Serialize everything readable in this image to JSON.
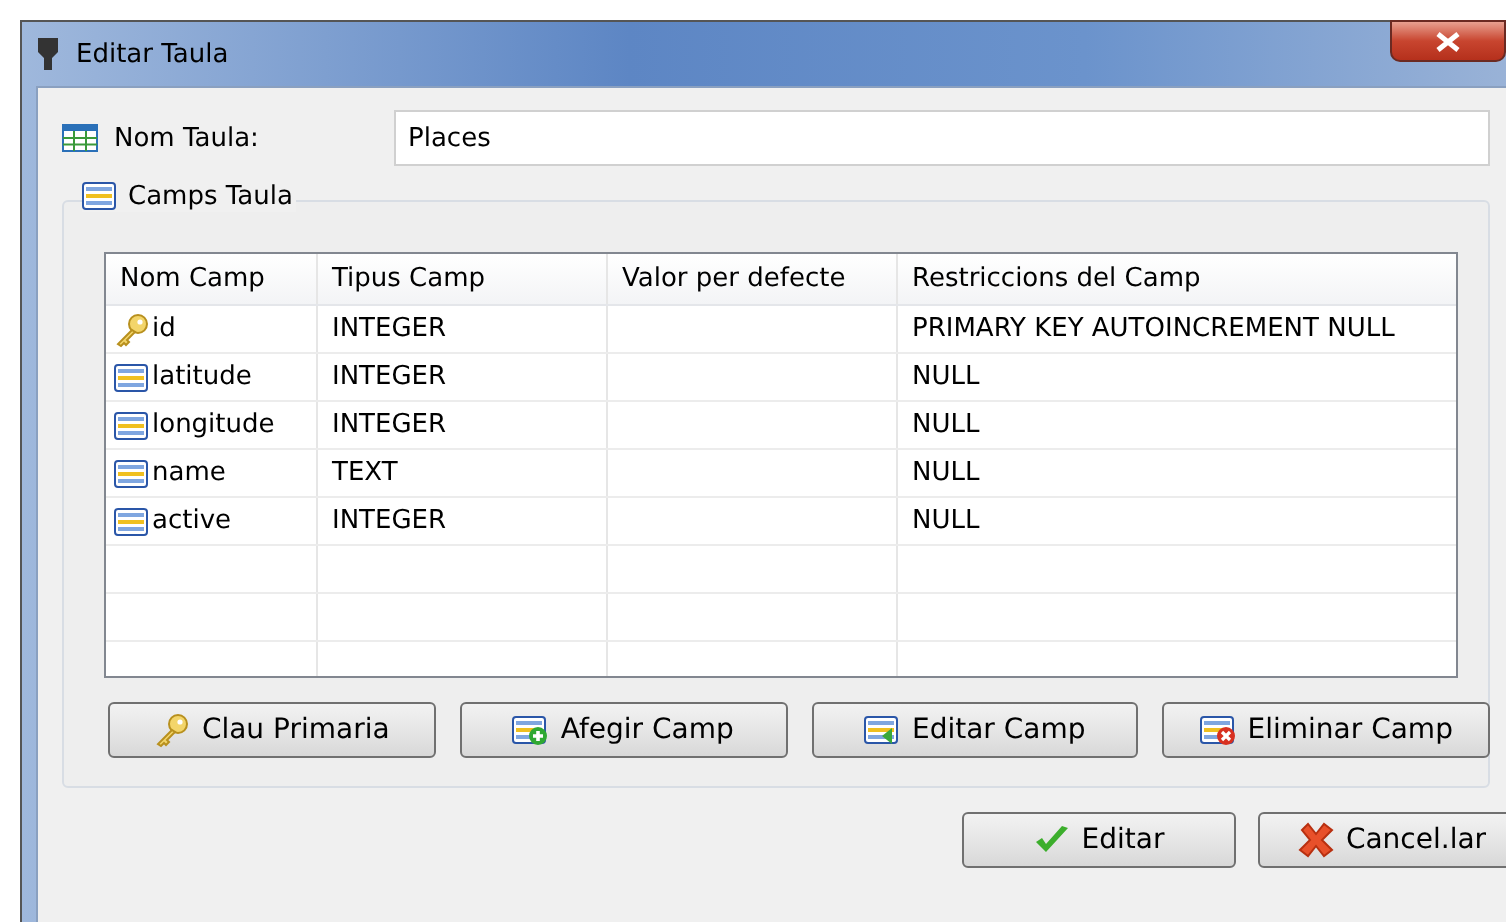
{
  "window": {
    "title": "Editar Taula"
  },
  "table_name": {
    "label": "Nom Taula:",
    "value": "Places"
  },
  "fields_group": {
    "title": "Camps Taula",
    "table": {
      "columns": [
        "Nom Camp",
        "Tipus Camp",
        "Valor per defecte",
        "Restriccions del Camp"
      ],
      "rows": [
        {
          "kind": "key",
          "cells": [
            "id",
            "INTEGER",
            "",
            "PRIMARY KEY AUTOINCREMENT NULL"
          ]
        },
        {
          "kind": "field",
          "cells": [
            "latitude",
            "INTEGER",
            "",
            "NULL"
          ]
        },
        {
          "kind": "field",
          "cells": [
            "longitude",
            "INTEGER",
            "",
            "NULL"
          ]
        },
        {
          "kind": "field",
          "cells": [
            "name",
            "TEXT",
            "",
            "NULL"
          ]
        },
        {
          "kind": "field",
          "cells": [
            "active",
            "INTEGER",
            "",
            "NULL"
          ]
        }
      ]
    },
    "buttons": [
      {
        "kind": "key",
        "label": "Clau Primaria"
      },
      {
        "kind": "add",
        "label": "Afegir Camp"
      },
      {
        "kind": "edit",
        "label": "Editar Camp"
      },
      {
        "kind": "delete",
        "label": "Eliminar Camp"
      }
    ]
  },
  "dialog_buttons": [
    {
      "kind": "ok",
      "label": "Editar"
    },
    {
      "kind": "cancel",
      "label": "Cancel.lar"
    }
  ]
}
